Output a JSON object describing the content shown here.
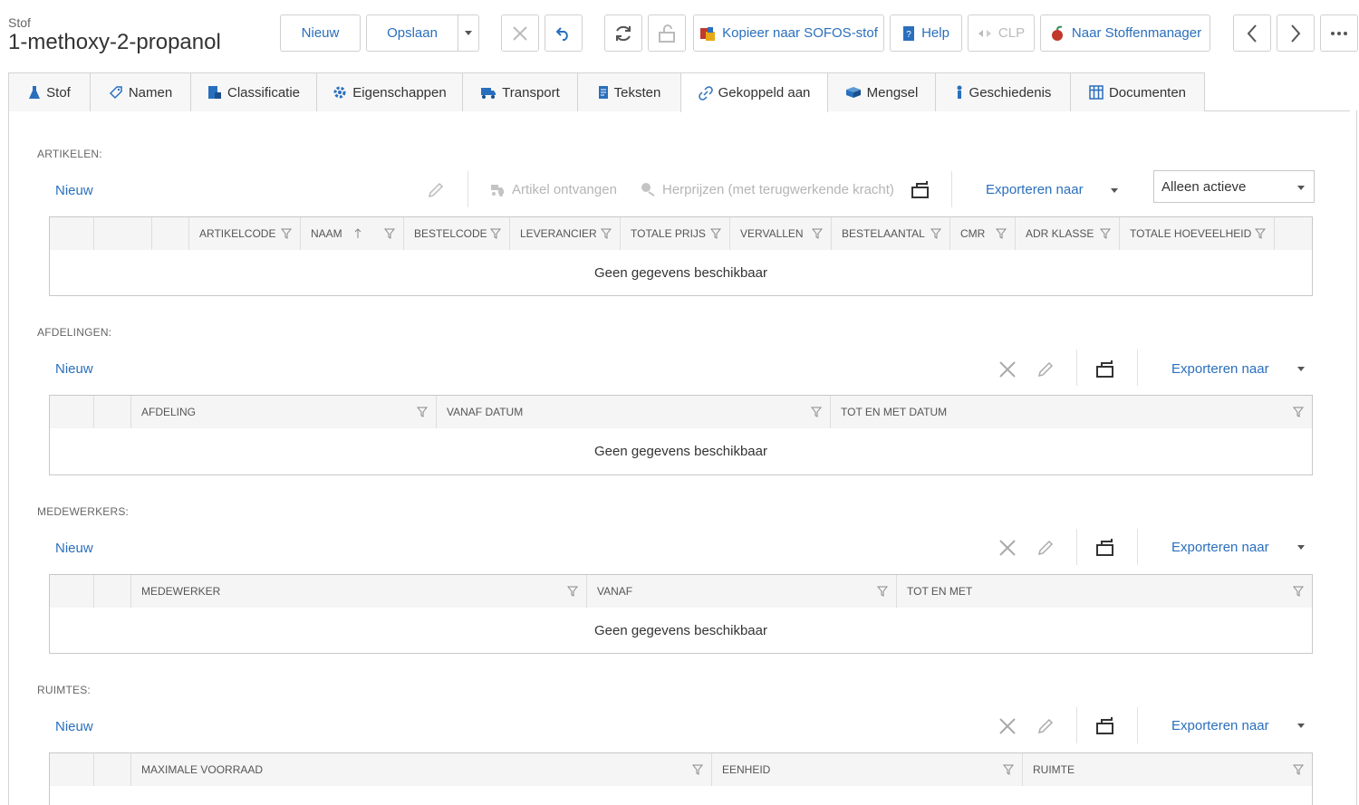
{
  "header": {
    "entity_type": "Stof",
    "title": "1-methoxy-2-propanol"
  },
  "toolbar": {
    "new_label": "Nieuw",
    "save_label": "Opslaan",
    "copy_label": "Kopieer naar SOFOS-stof",
    "help_label": "Help",
    "clp_label": "CLP",
    "manager_label": "Naar Stoffenmanager"
  },
  "tabs": [
    {
      "label": "Stof",
      "icon": "flask-icon"
    },
    {
      "label": "Namen",
      "icon": "tag-icon"
    },
    {
      "label": "Classificatie",
      "icon": "classification-icon"
    },
    {
      "label": "Eigenschappen",
      "icon": "gear-icon"
    },
    {
      "label": "Transport",
      "icon": "truck-icon"
    },
    {
      "label": "Teksten",
      "icon": "document-icon"
    },
    {
      "label": "Gekoppeld aan",
      "icon": "link-icon"
    },
    {
      "label": "Mengsel",
      "icon": "box-icon"
    },
    {
      "label": "Geschiedenis",
      "icon": "history-icon"
    },
    {
      "label": "Documenten",
      "icon": "grid-icon"
    }
  ],
  "active_tab": "Gekoppeld aan",
  "sections": {
    "artikelen": {
      "label": "ARTIKELEN:",
      "new_label": "Nieuw",
      "receive_label": "Artikel ontvangen",
      "reprice_label": "Herprijzen (met terugwerkende kracht)",
      "export_label": "Exporteren naar",
      "filter_value": "Alleen actieve",
      "columns": [
        "ARTIKELCODE",
        "NAAM",
        "BESTELCODE",
        "LEVERANCIER",
        "TOTALE PRIJS",
        "VERVALLEN",
        "BESTELAANTAL",
        "CMR",
        "ADR KLASSE",
        "TOTALE HOEVEELHEID"
      ],
      "empty_text": "Geen gegevens beschikbaar"
    },
    "afdelingen": {
      "label": "AFDELINGEN:",
      "new_label": "Nieuw",
      "export_label": "Exporteren naar",
      "columns": [
        "AFDELING",
        "VANAF DATUM",
        "TOT EN MET DATUM"
      ],
      "empty_text": "Geen gegevens beschikbaar"
    },
    "medewerkers": {
      "label": "MEDEWERKERS:",
      "new_label": "Nieuw",
      "export_label": "Exporteren naar",
      "columns": [
        "MEDEWERKER",
        "VANAF",
        "TOT EN MET"
      ],
      "empty_text": "Geen gegevens beschikbaar"
    },
    "ruimtes": {
      "label": "RUIMTES:",
      "new_label": "Nieuw",
      "export_label": "Exporteren naar",
      "columns": [
        "MAXIMALE VOORRAAD",
        "EENHEID",
        "RUIMTE"
      ]
    }
  },
  "colors": {
    "accent": "#2a6fbd",
    "border": "#c8c8c8",
    "header_bg": "#f5f5f5",
    "disabled": "#b5b5b5"
  }
}
